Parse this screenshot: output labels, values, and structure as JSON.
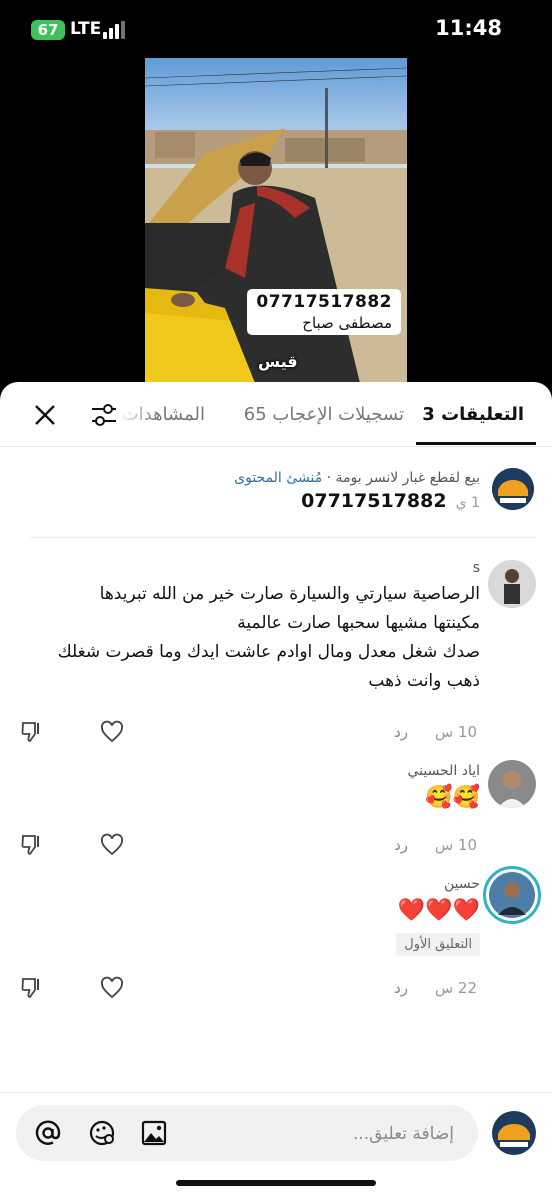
{
  "status_bar": {
    "battery": "67",
    "network": "LTE",
    "time": "11:48"
  },
  "video": {
    "caption_phone": "07717517882",
    "caption_name": "مصطفى صباح",
    "overlay_name": "قيس"
  },
  "tabs": [
    {
      "label": "التعليقات 3",
      "active": true
    },
    {
      "label": "تسجيلات الإعجاب 65",
      "active": false
    },
    {
      "label": "المشاهدات",
      "active": false
    }
  ],
  "creator_comment": {
    "username": "بيع لقطع غبار لانسر بومة",
    "badge": "مُنشئ المحتوى",
    "separator": "·",
    "text": "07717517882",
    "time": "1 ي"
  },
  "comments": [
    {
      "username": "s",
      "lines": [
        "الرصاصية سيارتي والسيارة صارت خير من الله تبريدها",
        "مكينتها مشيها سحبها صارت عالمية",
        "صدك شغل معدل ومال اوادم عاشت ايدك وما قصرت شغلك",
        "ذهب وانت ذهب"
      ],
      "time": "10 س",
      "reply": "رد"
    },
    {
      "username": "اياد الحسيني",
      "lines": [
        "🥰🥰"
      ],
      "time": "10 س",
      "reply": "رد"
    },
    {
      "username": "حسين",
      "lines": [
        "❤️❤️❤️"
      ],
      "badge": "التعليق الأول",
      "time": "22 س",
      "reply": "رد"
    }
  ],
  "input": {
    "placeholder": "إضافة تعليق..."
  },
  "colors": {
    "badge_blue": "#2f6da3",
    "heart": "#e0202a",
    "story_ring": "#2bb3c6"
  }
}
